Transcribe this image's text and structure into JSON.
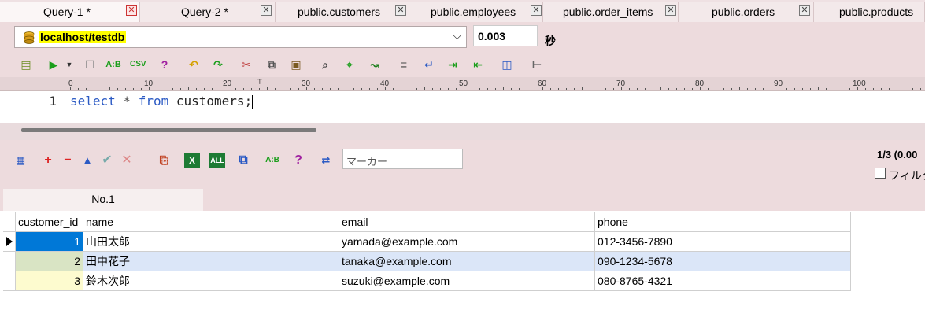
{
  "tabs": [
    {
      "label": "Query-1 *",
      "active": true
    },
    {
      "label": "Query-2 *",
      "active": false
    },
    {
      "label": "public.customers",
      "active": false
    },
    {
      "label": "public.employees",
      "active": false
    },
    {
      "label": "public.order_items",
      "active": false
    },
    {
      "label": "public.orders",
      "active": false
    },
    {
      "label": "public.products",
      "active": false
    }
  ],
  "connection": {
    "name": "localhost/testdb"
  },
  "timing": {
    "value": "0.003",
    "unit": "秒"
  },
  "ruler": {
    "labels": [
      "0",
      "10",
      "20",
      "30",
      "40",
      "50",
      "60",
      "70",
      "80",
      "90",
      "100"
    ]
  },
  "editor": {
    "line_number": "1",
    "tokens": {
      "kw1": "select",
      "op": " * ",
      "kw2": "from",
      "ident": " customers;"
    }
  },
  "results": {
    "marker_placeholder": "マーカー",
    "pager": "1/3 (0.00",
    "filter_label": "フィルタ",
    "result_tab": "No.1"
  },
  "grid": {
    "columns": [
      "customer_id",
      "name",
      "email",
      "phone"
    ],
    "rows": [
      {
        "customer_id": "1",
        "name": "山田太郎",
        "email": "yamada@example.com",
        "phone": "012-3456-7890"
      },
      {
        "customer_id": "2",
        "name": "田中花子",
        "email": "tanaka@example.com",
        "phone": "090-1234-5678"
      },
      {
        "customer_id": "3",
        "name": "鈴木次郎",
        "email": "suzuki@example.com",
        "phone": "080-8765-4321"
      }
    ]
  },
  "colors": {
    "accent": "#0078d7",
    "highlight": "#ffff00",
    "selected_row": "#dbe6f8"
  }
}
